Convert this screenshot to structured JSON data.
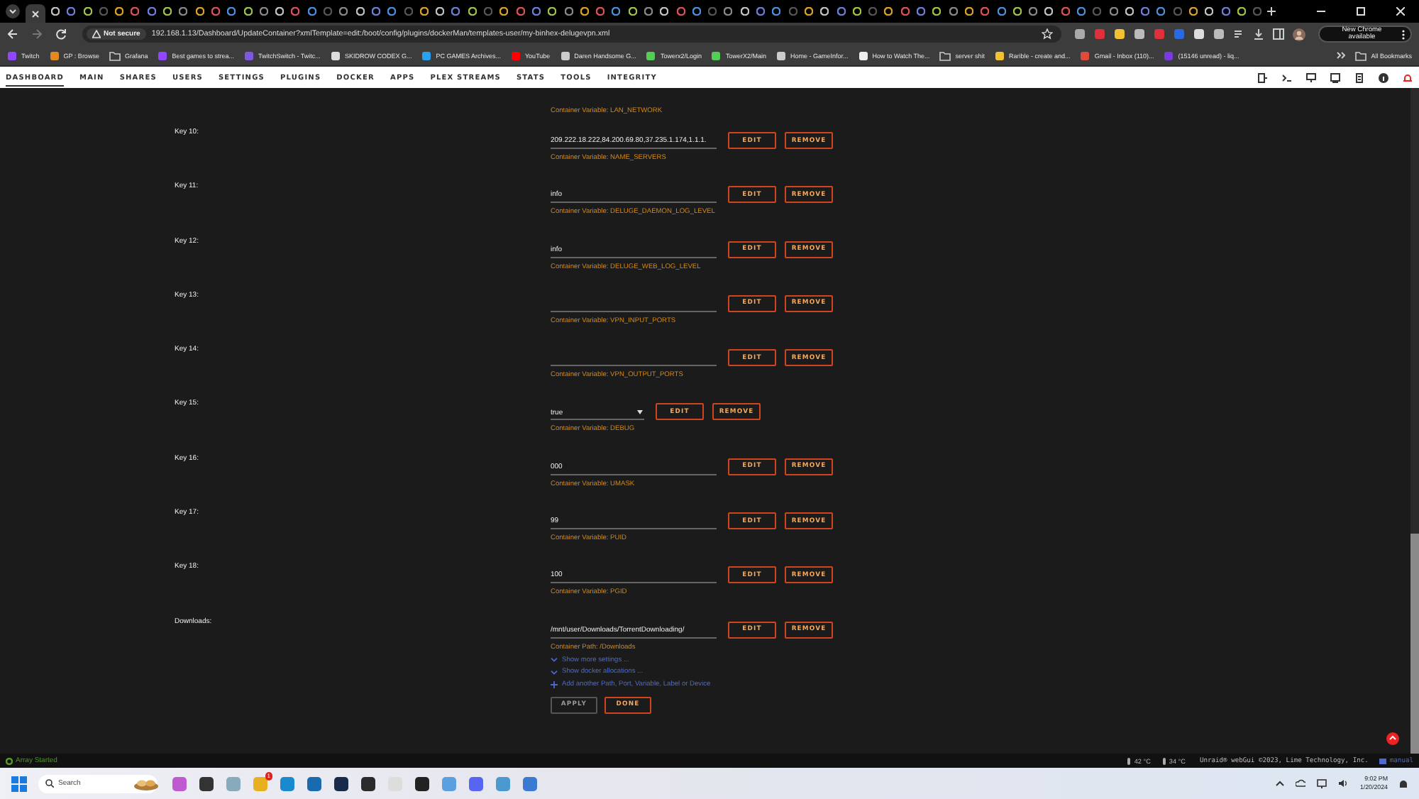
{
  "browser": {
    "security": "Not secure",
    "url": "192.168.1.13/Dashboard/UpdateContainer?xmlTemplate=edit:/boot/config/plugins/dockerMan/templates-user/my-binhex-delugevpn.xml",
    "update_button": "New Chrome available"
  },
  "bookmarks": [
    {
      "label": "Twitch",
      "kind": "site"
    },
    {
      "label": "GP : Browse",
      "kind": "site"
    },
    {
      "label": "Grafana",
      "kind": "folder"
    },
    {
      "label": "Best games to strea...",
      "kind": "site"
    },
    {
      "label": "TwitchSwitch - Twitc...",
      "kind": "site"
    },
    {
      "label": "SKIDROW CODEX G...",
      "kind": "site"
    },
    {
      "label": "PC GAMES Archives...",
      "kind": "site"
    },
    {
      "label": "YouTube",
      "kind": "site"
    },
    {
      "label": "Daren Handsome G...",
      "kind": "site"
    },
    {
      "label": "Towerx2/Login",
      "kind": "site"
    },
    {
      "label": "TowerX2/Main",
      "kind": "site"
    },
    {
      "label": "Home - GameInfor...",
      "kind": "site"
    },
    {
      "label": "How to Watch The...",
      "kind": "site"
    },
    {
      "label": "server shit",
      "kind": "folder"
    },
    {
      "label": "Rarible - create and...",
      "kind": "site"
    },
    {
      "label": "Gmail - Inbox (110)...",
      "kind": "site"
    },
    {
      "label": "(15146 unread) - liq...",
      "kind": "site"
    }
  ],
  "all_bookmarks": "All Bookmarks",
  "nav": [
    {
      "label": "DASHBOARD",
      "selected": true
    },
    {
      "label": "MAIN",
      "selected": false
    },
    {
      "label": "SHARES",
      "selected": false
    },
    {
      "label": "USERS",
      "selected": false
    },
    {
      "label": "SETTINGS",
      "selected": false
    },
    {
      "label": "PLUGINS",
      "selected": false
    },
    {
      "label": "DOCKER",
      "selected": false
    },
    {
      "label": "APPS",
      "selected": false
    },
    {
      "label": "PLEX STREAMS",
      "selected": false
    },
    {
      "label": "STATS",
      "selected": false
    },
    {
      "label": "TOOLS",
      "selected": false
    },
    {
      "label": "INTEGRITY",
      "selected": false
    }
  ],
  "form": {
    "partial_description": "Container Variable: LAN_NETWORK",
    "rows": [
      {
        "label": "Key 10:",
        "kind": "text",
        "value": "209.222.18.222,84.200.69.80,37.235.1.174,1.1.1.",
        "edit": "EDIT",
        "remove": "REMOVE",
        "description": "Container Variable: NAME_SERVERS"
      },
      {
        "label": "Key 11:",
        "kind": "text",
        "value": "info",
        "edit": "EDIT",
        "remove": "REMOVE",
        "description": "Container Variable: DELUGE_DAEMON_LOG_LEVEL"
      },
      {
        "label": "Key 12:",
        "kind": "text",
        "value": "info",
        "edit": "EDIT",
        "remove": "REMOVE",
        "description": "Container Variable: DELUGE_WEB_LOG_LEVEL"
      },
      {
        "label": "Key 13:",
        "kind": "text",
        "edit": "EDIT",
        "remove": "REMOVE",
        "description": "Container Variable: VPN_INPUT_PORTS"
      },
      {
        "label": "Key 14:",
        "kind": "text",
        "edit": "EDIT",
        "remove": "REMOVE",
        "description": "Container Variable: VPN_OUTPUT_PORTS"
      },
      {
        "label": "Key 15:",
        "kind": "select",
        "value": "true",
        "edit": "EDIT",
        "remove": "REMOVE",
        "description": "Container Variable: DEBUG"
      },
      {
        "label": "Key 16:",
        "kind": "text",
        "value": "000",
        "edit": "EDIT",
        "remove": "REMOVE",
        "description": "Container Variable: UMASK"
      },
      {
        "label": "Key 17:",
        "kind": "text",
        "value": "99",
        "edit": "EDIT",
        "remove": "REMOVE",
        "description": "Container Variable: PUID"
      },
      {
        "label": "Key 18:",
        "kind": "text",
        "value": "100",
        "edit": "EDIT",
        "remove": "REMOVE",
        "description": "Container Variable: PGID"
      },
      {
        "label": "Downloads:",
        "kind": "text",
        "value": "/mnt/user/Downloads/TorrentDownloading/",
        "edit": "EDIT",
        "remove": "REMOVE",
        "description": "Container Path: /Downloads"
      }
    ],
    "links": [
      {
        "label": "Show more settings ...",
        "kind": "expand"
      },
      {
        "label": "Show docker allocations ...",
        "kind": "expand"
      },
      {
        "label": "Add another Path, Port, Variable, Label or Device",
        "kind": "add"
      }
    ],
    "actions": [
      {
        "label": "APPLY",
        "disabled": true
      },
      {
        "label": "DONE",
        "disabled": false
      }
    ]
  },
  "status_bar": {
    "array": "Array Started",
    "temps": [
      "42 °C",
      "34 °C"
    ],
    "copyright": "Unraid® webGui ©2023, Lime Technology, Inc.",
    "manual": "manual"
  },
  "taskbar": {
    "search_placeholder": "Search",
    "badge": "1",
    "time": "9:02 PM",
    "date": "1/20/2024"
  }
}
